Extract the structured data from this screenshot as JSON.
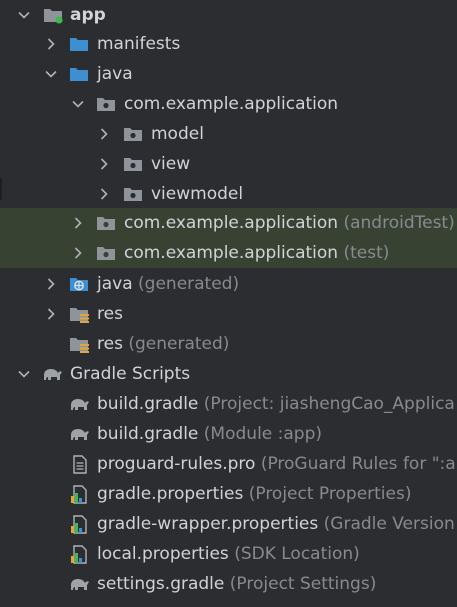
{
  "tree": {
    "rows": [
      {
        "label": "app",
        "hint": "",
        "icon": "module-folder-icon",
        "chevron": "down"
      },
      {
        "label": "manifests",
        "hint": "",
        "icon": "folder-icon",
        "chevron": "right"
      },
      {
        "label": "java",
        "hint": "",
        "icon": "source-folder-icon",
        "chevron": "down"
      },
      {
        "label": "com.example.application",
        "hint": "",
        "icon": "package-icon",
        "chevron": "down"
      },
      {
        "label": "model",
        "hint": "",
        "icon": "package-icon",
        "chevron": "right"
      },
      {
        "label": "view",
        "hint": "",
        "icon": "package-icon",
        "chevron": "right"
      },
      {
        "label": "viewmodel",
        "hint": "",
        "icon": "package-icon",
        "chevron": "right"
      },
      {
        "label": "com.example.application",
        "hint": "(androidTest)",
        "icon": "package-icon",
        "chevron": "right"
      },
      {
        "label": "com.example.application",
        "hint": "(test)",
        "icon": "package-icon",
        "chevron": "right"
      },
      {
        "label": "java",
        "hint": "(generated)",
        "icon": "generated-source-folder-icon",
        "chevron": "right"
      },
      {
        "label": "res",
        "hint": "",
        "icon": "resource-folder-icon",
        "chevron": "right"
      },
      {
        "label": "res",
        "hint": "(generated)",
        "icon": "resource-folder-icon",
        "chevron": "none"
      },
      {
        "label": "Gradle Scripts",
        "hint": "",
        "icon": "gradle-elephant-icon",
        "chevron": "down"
      },
      {
        "label": "build.gradle",
        "hint": "(Project: jiashengCao_Applica",
        "icon": "gradle-elephant-icon",
        "chevron": "none"
      },
      {
        "label": "build.gradle",
        "hint": "(Module :app)",
        "icon": "gradle-elephant-icon",
        "chevron": "none"
      },
      {
        "label": "proguard-rules.pro",
        "hint": "(ProGuard Rules for \":a",
        "icon": "text-file-icon",
        "chevron": "none"
      },
      {
        "label": "gradle.properties",
        "hint": "(Project Properties)",
        "icon": "properties-file-icon",
        "chevron": "none"
      },
      {
        "label": "gradle-wrapper.properties",
        "hint": "(Gradle Version",
        "icon": "properties-file-icon",
        "chevron": "none"
      },
      {
        "label": "local.properties",
        "hint": "(SDK Location)",
        "icon": "properties-file-icon",
        "chevron": "none"
      },
      {
        "label": "settings.gradle",
        "hint": "(Project Settings)",
        "icon": "gradle-elephant-icon",
        "chevron": "none"
      }
    ]
  },
  "colors": {
    "background": "#2b2d30",
    "highlight": "#374233",
    "text": "#d0d3d8",
    "hint": "#868a91",
    "folder_blue": "#3d8fd1",
    "package_gray": "#8f949b",
    "green_dot": "#3fb950"
  }
}
